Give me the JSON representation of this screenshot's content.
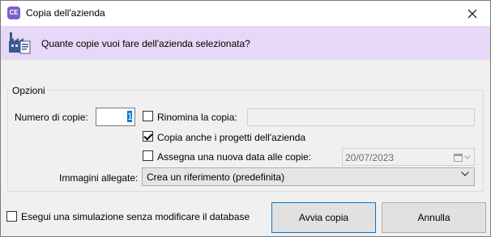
{
  "window": {
    "app_icon_text": "CE",
    "title": "Copia dell'azienda",
    "close_glyph": "✕"
  },
  "banner": {
    "icon": "factory-document-icon",
    "question": "Quante copie vuoi fare dell'azienda selezionata?",
    "background": "#e6d8f6"
  },
  "options": {
    "legend": "Opzioni",
    "num_copies_label": "Numero di copie:",
    "num_copies_value": "1",
    "rename": {
      "label": "Rinomina la copia:",
      "checked": false,
      "value": ""
    },
    "copy_projects": {
      "label": "Copia anche i progetti dell'azienda",
      "checked": true
    },
    "new_date": {
      "label": "Assegna una nuova data alle copie:",
      "checked": false,
      "date": "20/07/2023"
    },
    "images_label": "Immagini allegate:",
    "images_selected": "Crea un riferimento (predefinita)"
  },
  "footer": {
    "simulate_label": "Esegui una simulazione senza modificare il database",
    "simulate_checked": false,
    "start_button": "Avvia copia",
    "cancel_button": "Annulla"
  },
  "colors": {
    "accent": "#0078d7",
    "app_icon": "#7d5fc7"
  }
}
